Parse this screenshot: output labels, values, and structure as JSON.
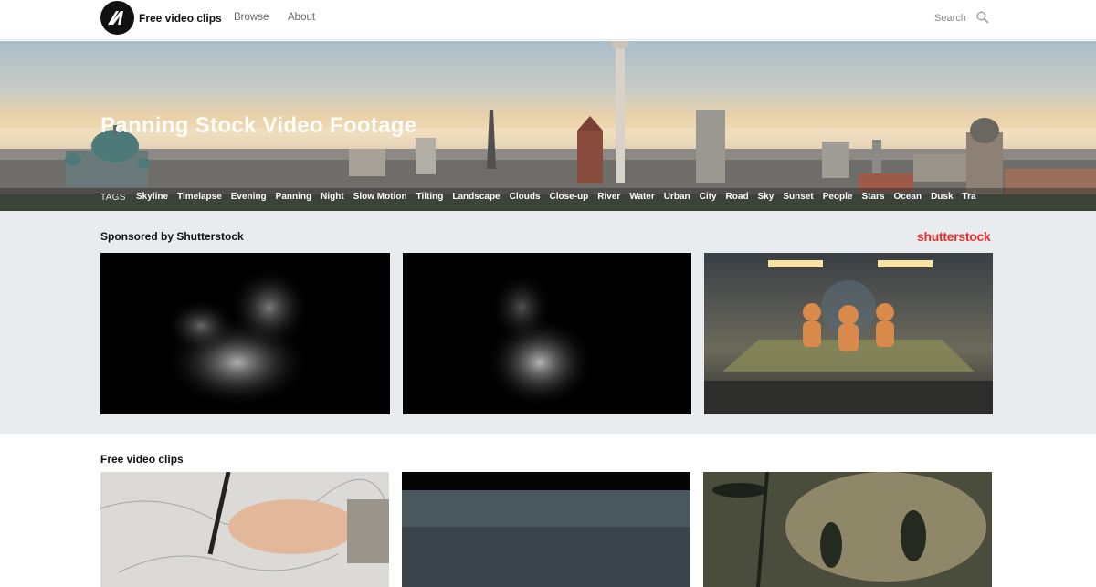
{
  "header": {
    "brand": "Free video clips",
    "nav": [
      {
        "label": "Browse"
      },
      {
        "label": "About"
      }
    ],
    "search_label": "Search",
    "logo_icon": "play-logo-icon",
    "search_icon": "search-icon"
  },
  "hero": {
    "title": "Panning Stock Video Footage",
    "tags_label": "TAGS",
    "tags": [
      "Skyline",
      "Timelapse",
      "Evening",
      "Panning",
      "Night",
      "Slow Motion",
      "Tilting",
      "Landscape",
      "Clouds",
      "Close-up",
      "River",
      "Water",
      "Urban",
      "City",
      "Road",
      "Sky",
      "Sunset",
      "People",
      "Stars",
      "Ocean",
      "Dusk",
      "Tra"
    ]
  },
  "sponsored": {
    "title": "Sponsored by Shutterstock",
    "logo_text": "shutterstock",
    "logo_color": "#e0312e"
  },
  "free": {
    "title": "Free video clips"
  }
}
